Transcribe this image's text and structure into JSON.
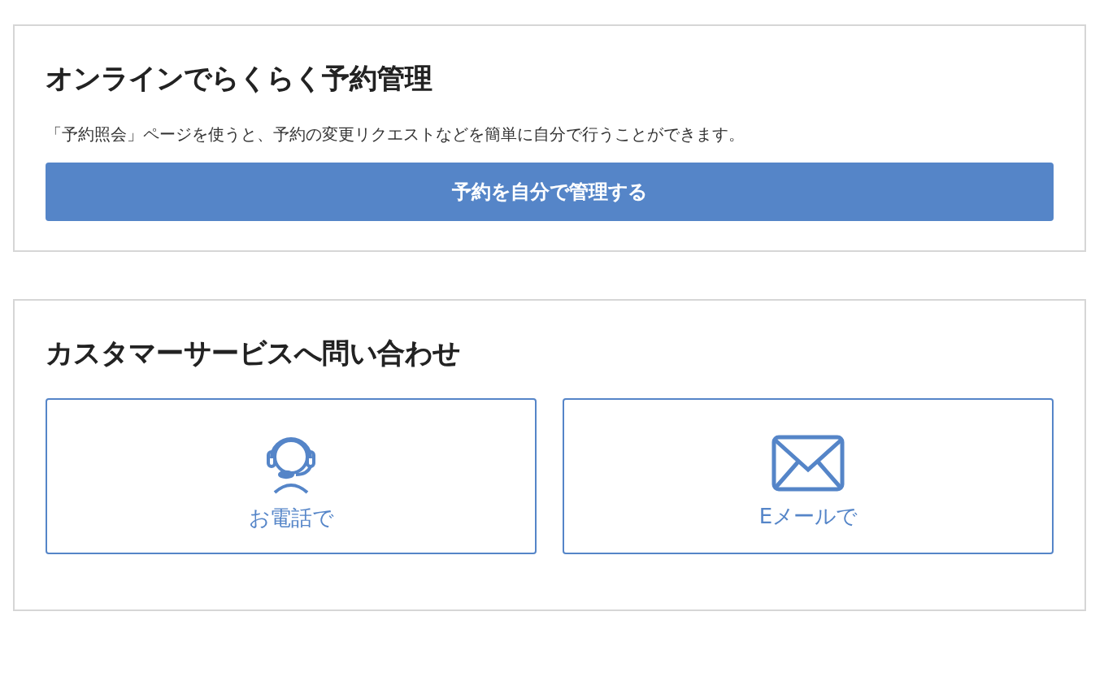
{
  "manage_card": {
    "title": "オンラインでらくらく予約管理",
    "description": "「予約照会」ページを使うと、予約の変更リクエストなどを簡単に自分で行うことができます。",
    "button": "予約を自分で管理する"
  },
  "contact_card": {
    "title": "カスタマーサービスへ問い合わせ",
    "options": [
      {
        "kind": "phone",
        "label": "お電話で"
      },
      {
        "kind": "email",
        "label": "Eメールで"
      }
    ]
  }
}
